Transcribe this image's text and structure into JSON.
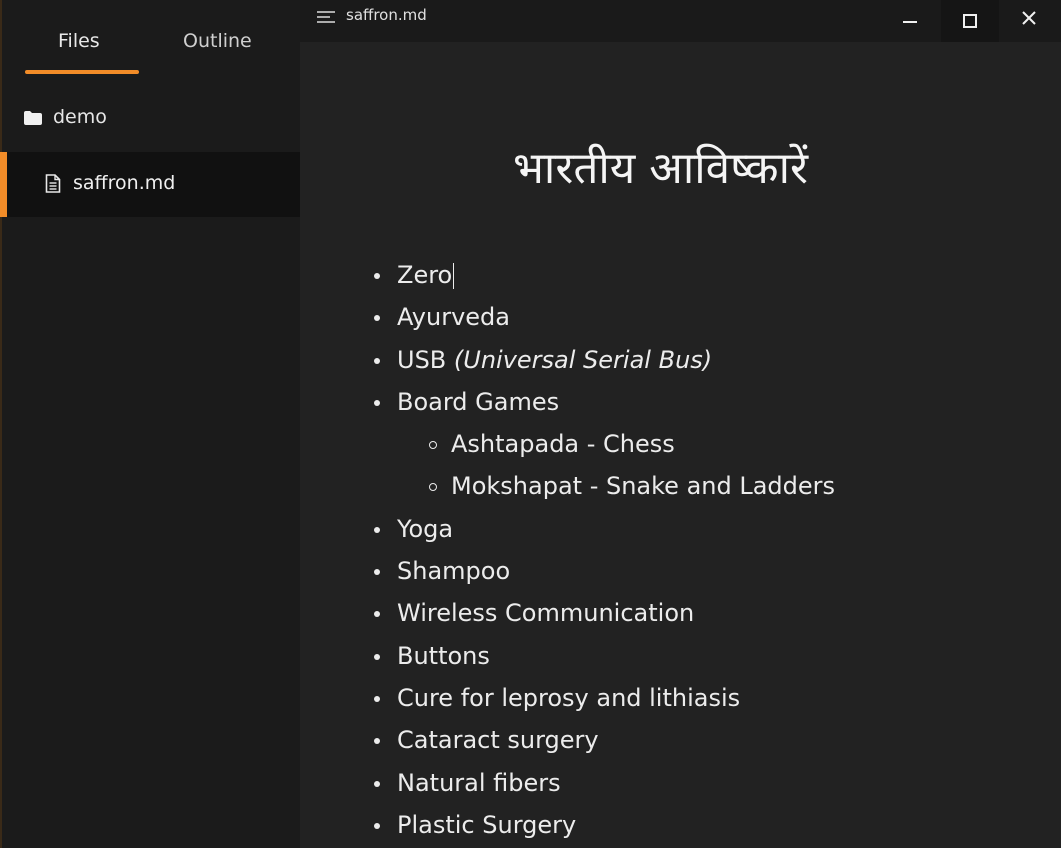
{
  "sidebar": {
    "tabs": [
      {
        "label": "Files",
        "active": true
      },
      {
        "label": "Outline",
        "active": false
      }
    ],
    "folder": {
      "name": "demo",
      "icon": "folder-icon"
    },
    "files": [
      {
        "name": "saffron.md",
        "icon": "file-icon",
        "selected": true
      }
    ]
  },
  "titlebar": {
    "menu_icon": "menu-icon",
    "document_title": "saffron.md",
    "controls": [
      "minimize-icon",
      "maximize-icon",
      "close-icon"
    ]
  },
  "editor": {
    "heading": "भारतीय आविष्कारें",
    "items": [
      {
        "text": "Zero",
        "level": 1,
        "cursor": true
      },
      {
        "text": "Ayurveda",
        "level": 1
      },
      {
        "text": "USB ",
        "italic": "(Universal Serial Bus)",
        "level": 1
      },
      {
        "text": "Board Games",
        "level": 1
      },
      {
        "text": "Ashtapada - Chess",
        "level": 2
      },
      {
        "text": "Mokshapat - Snake and Ladders",
        "level": 2
      },
      {
        "text": "Yoga",
        "level": 1
      },
      {
        "text": "Shampoo",
        "level": 1
      },
      {
        "text": "Wireless Communication",
        "level": 1
      },
      {
        "text": "Buttons",
        "level": 1
      },
      {
        "text": "Cure for leprosy and lithiasis",
        "level": 1
      },
      {
        "text": "Cataract surgery",
        "level": 1
      },
      {
        "text": "Natural fibers",
        "level": 1
      },
      {
        "text": "Plastic Surgery",
        "level": 1
      }
    ]
  },
  "colors": {
    "accent": "#f28c28",
    "sidebar_bg": "#1b1b1b",
    "editor_bg": "#222222",
    "text": "#ececec"
  }
}
